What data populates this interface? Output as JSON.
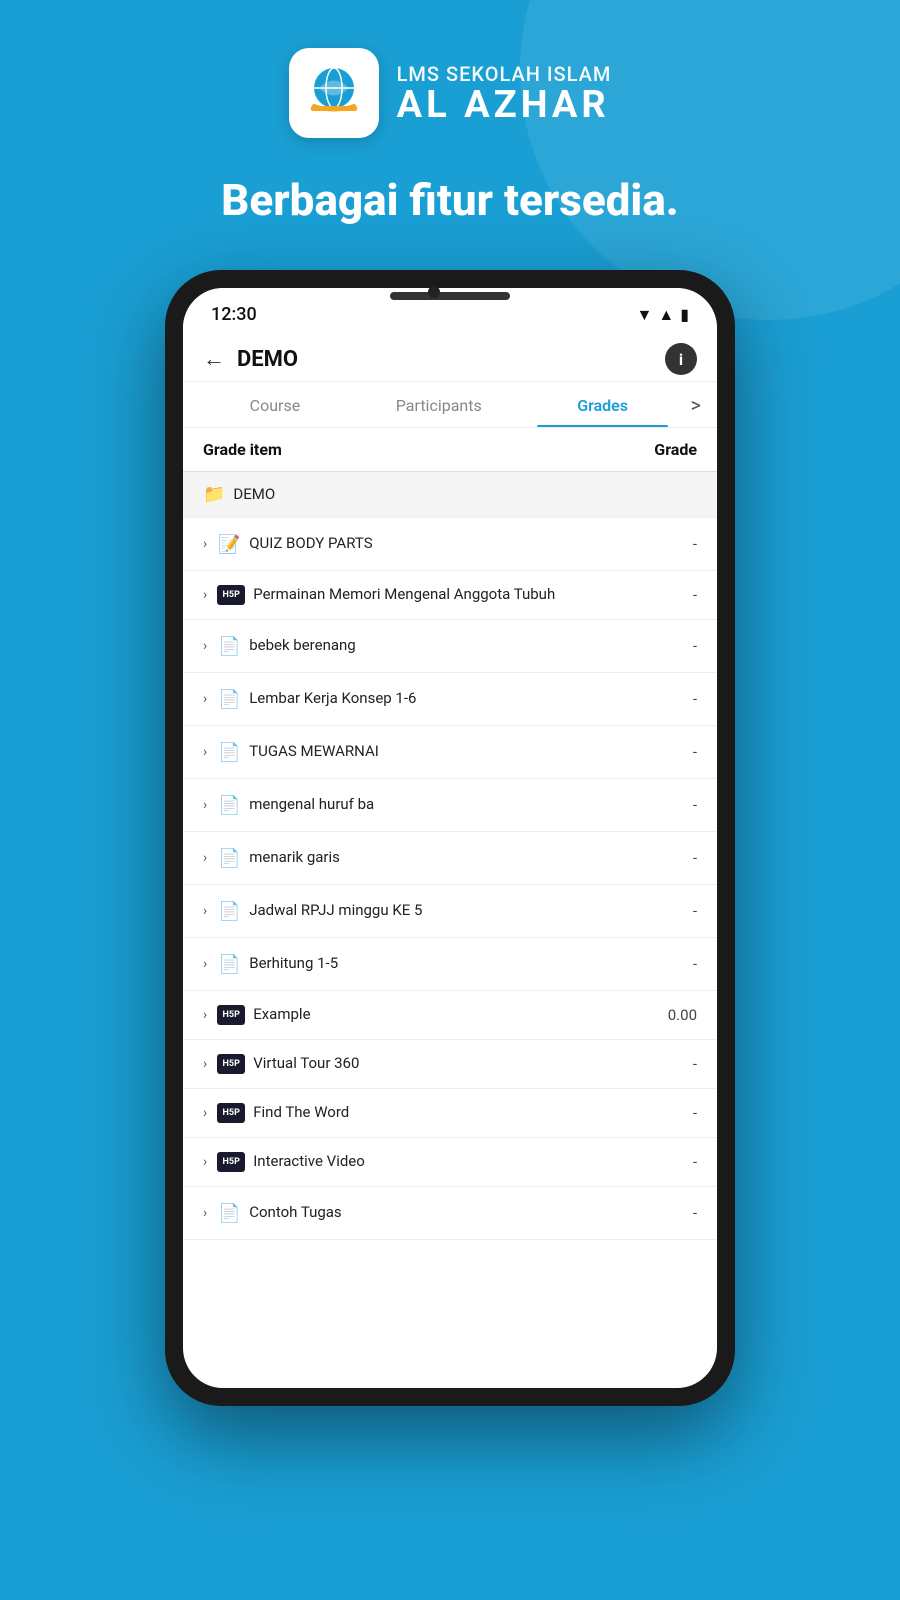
{
  "background": {
    "color": "#1a9fd4"
  },
  "header": {
    "logo_text_top": "LMS SEKOLAH ISLAM",
    "logo_text_bottom": "AL AZHAR",
    "tagline": "Berbagai fitur tersedia."
  },
  "status_bar": {
    "time": "12:30",
    "signal_icon": "▼▲",
    "battery_icon": "🔋"
  },
  "app_bar": {
    "back_icon": "←",
    "title": "DEMO",
    "info_icon": "i"
  },
  "tabs": [
    {
      "label": "Course",
      "active": false
    },
    {
      "label": "Participants",
      "active": false
    },
    {
      "label": "Grades",
      "active": true
    }
  ],
  "tab_arrow": ">",
  "grade_header": {
    "item_label": "Grade item",
    "grade_label": "Grade"
  },
  "grade_items": [
    {
      "type": "section",
      "icon": "folder",
      "label": "DEMO",
      "grade": ""
    },
    {
      "type": "item",
      "icon": "quiz",
      "label": "QUIZ BODY PARTS",
      "grade": "-"
    },
    {
      "type": "item",
      "icon": "h5p",
      "label": "Permainan Memori Mengenal Anggota Tubuh",
      "grade": "-"
    },
    {
      "type": "item",
      "icon": "file",
      "label": "bebek berenang",
      "grade": "-"
    },
    {
      "type": "item",
      "icon": "file",
      "label": "Lembar Kerja Konsep 1-6",
      "grade": "-"
    },
    {
      "type": "item",
      "icon": "file",
      "label": "TUGAS MEWARNAI",
      "grade": "-"
    },
    {
      "type": "item",
      "icon": "file",
      "label": "mengenal huruf ba",
      "grade": "-"
    },
    {
      "type": "item",
      "icon": "file",
      "label": "menarik garis",
      "grade": "-"
    },
    {
      "type": "item",
      "icon": "file",
      "label": "Jadwal RPJJ minggu KE 5",
      "grade": "-"
    },
    {
      "type": "item",
      "icon": "file",
      "label": "Berhitung 1-5",
      "grade": "-"
    },
    {
      "type": "item",
      "icon": "h5p",
      "label": "Example",
      "grade": "0.00"
    },
    {
      "type": "item",
      "icon": "h5p",
      "label": "Virtual Tour 360",
      "grade": "-"
    },
    {
      "type": "item",
      "icon": "h5p",
      "label": "Find The Word",
      "grade": "-"
    },
    {
      "type": "item",
      "icon": "h5p",
      "label": "Interactive Video",
      "grade": "-"
    },
    {
      "type": "item",
      "icon": "file",
      "label": "Contoh Tugas",
      "grade": "-"
    }
  ]
}
